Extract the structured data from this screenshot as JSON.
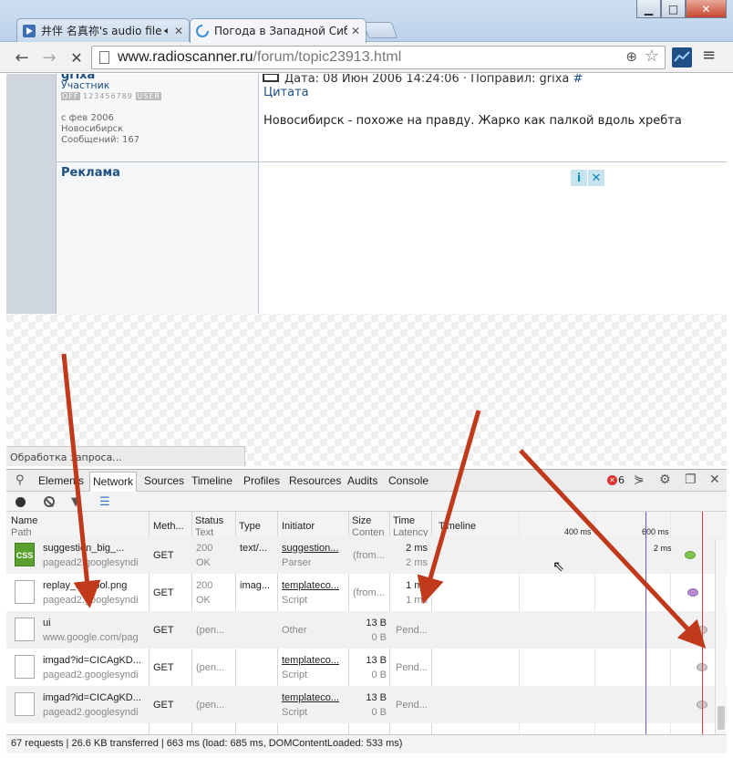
{
  "window": {
    "tabs": [
      {
        "label": "井伴 名真祢's audio file",
        "sound_icon": "speaker-icon"
      },
      {
        "label": "Погода в Западной Сиби",
        "active": true
      }
    ],
    "controls": {
      "minimize": "▁",
      "maximize": "□",
      "close": "✕"
    }
  },
  "toolbar": {
    "url_host": "www.radioscanner.ru",
    "url_path": "/forum/topic23913.html"
  },
  "page": {
    "user": {
      "name": "grixa",
      "role": "Участник",
      "rank": "123456789",
      "since": "с фев 2006",
      "city": "Новосибирск",
      "messages": "Сообщений: 167"
    },
    "post": {
      "meta": "Дата: 08 Июн 2006 14:24:06 · Поправил: grixa",
      "hash": "#",
      "quote": "Цитата",
      "text": "Новосибирск - похоже на правду. Жарко как палкой вдоль хребта"
    },
    "ad_title": "Реклама",
    "ad_info": "i",
    "ad_close": "✕",
    "status_bubble": "Обработка запроса..."
  },
  "devtools": {
    "tabs": [
      "Elements",
      "Network",
      "Sources",
      "Timeline",
      "Profiles",
      "Resources",
      "Audits",
      "Console"
    ],
    "active_tab": "Network",
    "error_count": "6",
    "columns": {
      "name": "Name",
      "path": "Path",
      "method": "Meth...",
      "status": "Status",
      "text": "Text",
      "type": "Type",
      "initiator": "Initiator",
      "size": "Size",
      "content": "Conten",
      "time": "Time",
      "latency": "Latency",
      "timeline": "Timeline"
    },
    "timeline_ticks": [
      "400 ms",
      "600 ms"
    ],
    "first_row_label": "2 ms",
    "rows": [
      {
        "name": "suggestion_big_...",
        "path": "pagead2.googlesyndi",
        "method": "GET",
        "status": "200",
        "status_text": "OK",
        "type": "text/...",
        "initiator": "suggestion...",
        "initiator_sub": "Parser",
        "size": "(from...",
        "content": "",
        "time": "2 ms",
        "latency": "2 ms",
        "icon": "css-file-icon",
        "dot_color": "#7ec64c"
      },
      {
        "name": "replay_symbol.png",
        "path": "pagead2.googlesyndi",
        "method": "GET",
        "status": "200",
        "status_text": "OK",
        "type": "imag...",
        "initiator": "templateco...",
        "initiator_sub": "Script",
        "size": "(from...",
        "content": "",
        "time": "1 ms",
        "latency": "1 ms",
        "icon": "image-file-icon",
        "dot_color": "#b58bd8"
      },
      {
        "name": "ui",
        "path": "www.google.com/pag",
        "method": "GET",
        "status": "(pen...",
        "status_text": "",
        "type": "",
        "initiator": "Other",
        "initiator_sub": "",
        "size": "13 B",
        "content": "0 B",
        "time": "Pend...",
        "latency": "",
        "icon": "file-icon",
        "dot_color": "#c9c9c9"
      },
      {
        "name": "imgad?id=CICAgKD...",
        "path": "pagead2.googlesyndi",
        "method": "GET",
        "status": "(pen...",
        "status_text": "",
        "type": "",
        "initiator": "templateco...",
        "initiator_sub": "Script",
        "size": "13 B",
        "content": "0 B",
        "time": "Pend...",
        "latency": "",
        "icon": "file-icon",
        "dot_color": "#c9c9c9"
      },
      {
        "name": "imgad?id=CICAgKD...",
        "path": "pagead2.googlesyndi",
        "method": "GET",
        "status": "(pen...",
        "status_text": "",
        "type": "",
        "initiator": "templateco...",
        "initiator_sub": "Script",
        "size": "13 B",
        "content": "0 B",
        "time": "Pend...",
        "latency": "",
        "icon": "file-icon",
        "dot_color": "#c9c9c9"
      }
    ],
    "summary": "67 requests | 26.6 KB transferred | 663 ms (load: 685 ms, DOMContentLoaded: 533 ms)"
  },
  "annotation_color": "#c0391b"
}
